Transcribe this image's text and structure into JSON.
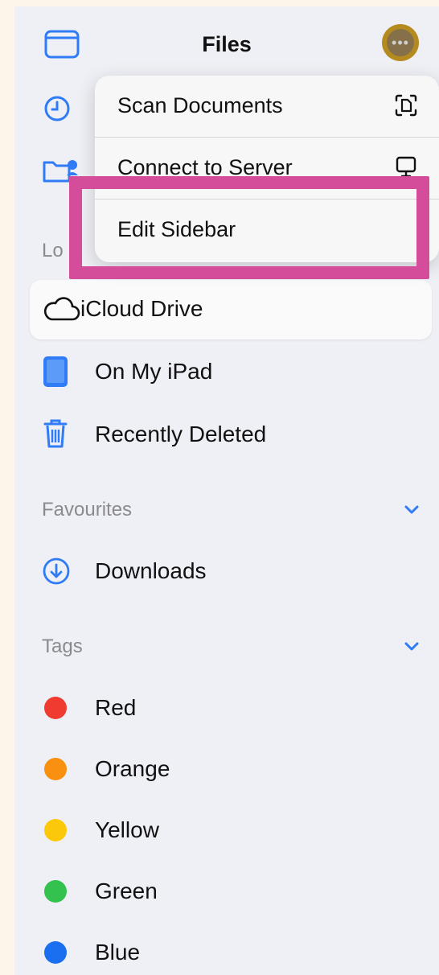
{
  "header": {
    "title": "Files"
  },
  "menu": {
    "items": [
      {
        "label": "Scan Documents",
        "icon": "scan-document-icon"
      },
      {
        "label": "Connect to Server",
        "icon": "monitor-icon"
      },
      {
        "label": "Edit Sidebar"
      }
    ]
  },
  "sections": {
    "locations_header_visible": "Lo",
    "favourites_header": "Favourites",
    "tags_header": "Tags"
  },
  "locations": [
    {
      "label": "iCloud Drive",
      "icon": "cloud-icon",
      "selected": true
    },
    {
      "label": "On My iPad",
      "icon": "ipad-icon"
    },
    {
      "label": "Recently Deleted",
      "icon": "trash-icon"
    }
  ],
  "favourites": [
    {
      "label": "Downloads",
      "icon": "download-icon"
    }
  ],
  "tags": [
    {
      "label": "Red",
      "color": "#ef3b30"
    },
    {
      "label": "Orange",
      "color": "#f9900f"
    },
    {
      "label": "Yellow",
      "color": "#fbc90a"
    },
    {
      "label": "Green",
      "color": "#33c24d"
    },
    {
      "label": "Blue",
      "color": "#1a6ff0"
    }
  ],
  "colors": {
    "accent": "#2f7cf6",
    "highlight_border": "#d44d9a",
    "background": "#eff0f5"
  }
}
